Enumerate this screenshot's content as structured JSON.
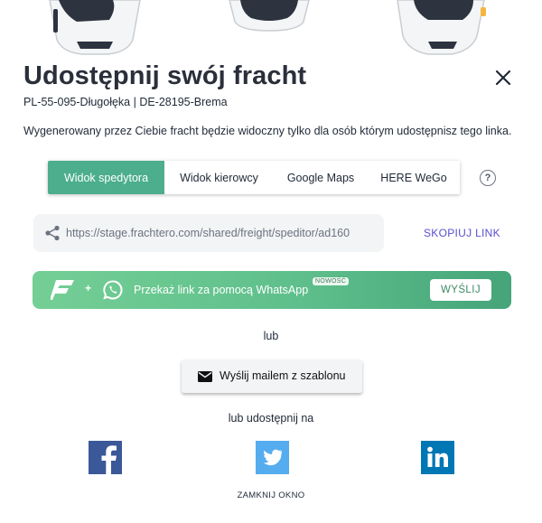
{
  "header": {
    "title": "Udostępnij swój fracht",
    "route": "PL-55-095-Długołęka | DE-28195-Brema",
    "description": "Wygenerowany przez Ciebie fracht będzie widoczny tylko dla osób którym udostępnisz tego linka."
  },
  "tabs": [
    {
      "label": "Widok spedytora",
      "active": true
    },
    {
      "label": "Widok kierowcy",
      "active": false
    },
    {
      "label": "Google Maps",
      "active": false
    },
    {
      "label": "HERE WeGo",
      "active": false
    }
  ],
  "help": {
    "label": "?"
  },
  "link": {
    "value": "https://stage.frachtero.com/shared/freight/speditor/ad160",
    "copy_label": "SKOPIUJ LINK"
  },
  "whatsapp": {
    "plus": "+",
    "text": "Przekaż link za pomocą WhatsApp",
    "badge": "NOWOŚĆ",
    "send_label": "WYŚLIJ"
  },
  "or_label": "lub",
  "email": {
    "label": "Wyślij mailem z szablonu"
  },
  "share_on_label": "lub udostępnij na",
  "social": [
    {
      "name": "facebook",
      "color": "#3b5998"
    },
    {
      "name": "twitter",
      "color": "#55acee"
    },
    {
      "name": "linkedin",
      "color": "#0077b5"
    }
  ],
  "close_window_label": "ZAMKNIJ OKNO",
  "colors": {
    "accent_tab": "#4cae8c",
    "link_color": "#5a4fcf",
    "whatsapp_gradient_start": "#74cf95",
    "whatsapp_gradient_end": "#45a579"
  }
}
